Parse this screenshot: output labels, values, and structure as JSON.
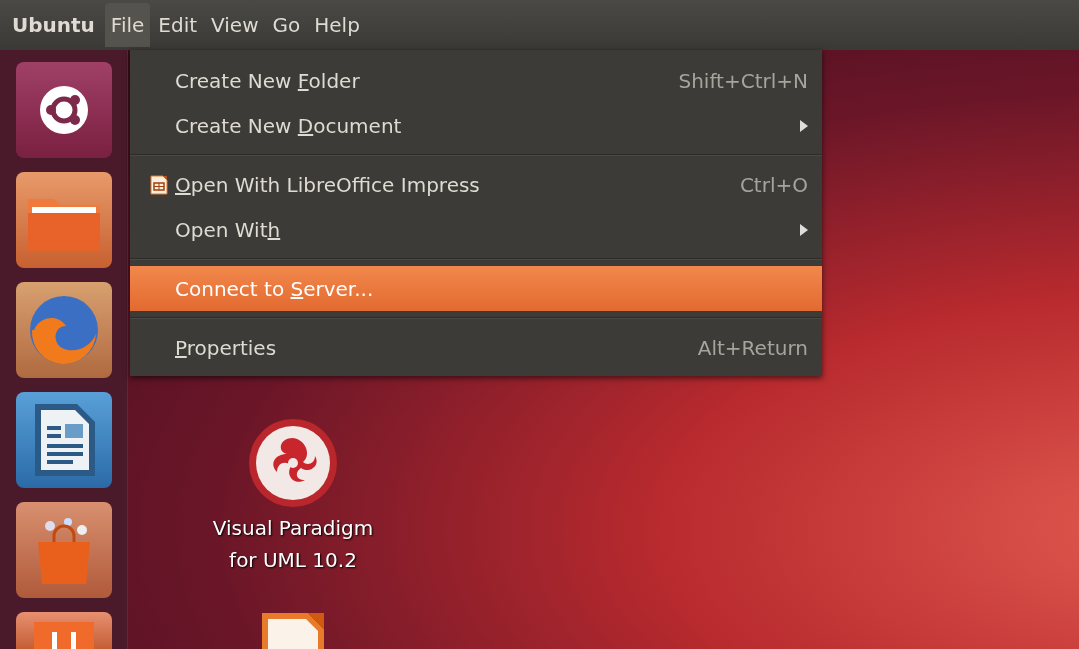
{
  "top_panel": {
    "app_name": "Ubuntu",
    "menus": [
      {
        "label": "File",
        "selected": true
      },
      {
        "label": "Edit",
        "selected": false
      },
      {
        "label": "View",
        "selected": false
      },
      {
        "label": "Go",
        "selected": false
      },
      {
        "label": "Help",
        "selected": false
      }
    ]
  },
  "file_menu": {
    "items": [
      {
        "kind": "item",
        "label": {
          "before": "Create New ",
          "mnemonic": "F",
          "after": "older"
        },
        "shortcut": "Shift+Ctrl+N",
        "submenu": false,
        "icon": false,
        "selected": false
      },
      {
        "kind": "item",
        "label": {
          "before": "Create New ",
          "mnemonic": "D",
          "after": "ocument"
        },
        "submenu": true,
        "icon": false,
        "selected": false
      },
      {
        "kind": "separator"
      },
      {
        "kind": "item",
        "label": {
          "mnemonic": "O",
          "after": "pen With LibreOffice Impress"
        },
        "shortcut": "Ctrl+O",
        "submenu": false,
        "icon": true,
        "selected": false
      },
      {
        "kind": "item",
        "label": {
          "before": "Open Wit",
          "mnemonic": "h"
        },
        "submenu": true,
        "icon": false,
        "selected": false
      },
      {
        "kind": "separator"
      },
      {
        "kind": "item",
        "label": {
          "before": "Connect to ",
          "mnemonic": "S",
          "after": "erver..."
        },
        "submenu": false,
        "icon": false,
        "selected": true
      },
      {
        "kind": "separator"
      },
      {
        "kind": "item",
        "label": {
          "mnemonic": "P",
          "after": "roperties"
        },
        "shortcut": "Alt+Return",
        "submenu": false,
        "icon": false,
        "selected": false
      }
    ]
  },
  "desktop": {
    "icons": [
      {
        "kind": "app",
        "label": "Visual Paradigm for UML 10.2"
      },
      {
        "kind": "presentation"
      }
    ]
  }
}
